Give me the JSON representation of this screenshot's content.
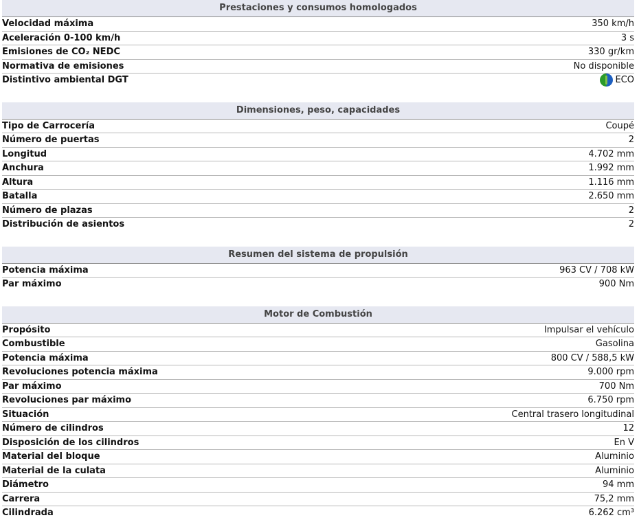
{
  "sections": [
    {
      "title": "Prestaciones y consumos homologados",
      "rows": [
        {
          "label": "Velocidad máxima",
          "value": "350 km/h"
        },
        {
          "label": "Aceleración 0-100 km/h",
          "value": "3 s"
        },
        {
          "label": "Emisiones de CO₂ NEDC",
          "value": "330 gr/km"
        },
        {
          "label": "Normativa de emisiones",
          "value": "No disponible"
        },
        {
          "label": "Distintivo ambiental DGT",
          "value": "ECO",
          "icon": "eco-badge-icon"
        }
      ]
    },
    {
      "title": "Dimensiones, peso, capacidades",
      "rows": [
        {
          "label": "Tipo de Carrocería",
          "value": "Coupé"
        },
        {
          "label": "Número de puertas",
          "value": "2"
        },
        {
          "label": "Longitud",
          "value": "4.702 mm"
        },
        {
          "label": "Anchura",
          "value": "1.992 mm"
        },
        {
          "label": "Altura",
          "value": "1.116 mm"
        },
        {
          "label": "Batalla",
          "value": "2.650 mm"
        },
        {
          "label": "Número de plazas",
          "value": "2"
        },
        {
          "label": "Distribución de asientos",
          "value": "2"
        }
      ]
    },
    {
      "title": "Resumen del sistema de propulsión",
      "rows": [
        {
          "label": "Potencia máxima",
          "value": "963 CV / 708 kW"
        },
        {
          "label": "Par máximo",
          "value": "900 Nm"
        }
      ]
    },
    {
      "title": "Motor de Combustión",
      "rows": [
        {
          "label": "Propósito",
          "value": "Impulsar el vehículo"
        },
        {
          "label": "Combustible",
          "value": "Gasolina"
        },
        {
          "label": "Potencia máxima",
          "value": "800 CV / 588,5 kW"
        },
        {
          "label": "Revoluciones potencia máxima",
          "value": "9.000 rpm"
        },
        {
          "label": "Par máximo",
          "value": "700 Nm"
        },
        {
          "label": "Revoluciones par máximo",
          "value": "6.750 rpm"
        },
        {
          "label": "Situación",
          "value": "Central trasero longitudinal"
        },
        {
          "label": "Número de cilindros",
          "value": "12"
        },
        {
          "label": "Disposición de los cilindros",
          "value": "En V"
        },
        {
          "label": "Material del bloque",
          "value": "Aluminio"
        },
        {
          "label": "Material de la culata",
          "value": "Aluminio"
        },
        {
          "label": "Diámetro",
          "value": "94 mm"
        },
        {
          "label": "Carrera",
          "value": "75,2 mm"
        },
        {
          "label": "Cilindrada",
          "value": "6.262 cm³"
        }
      ]
    }
  ]
}
